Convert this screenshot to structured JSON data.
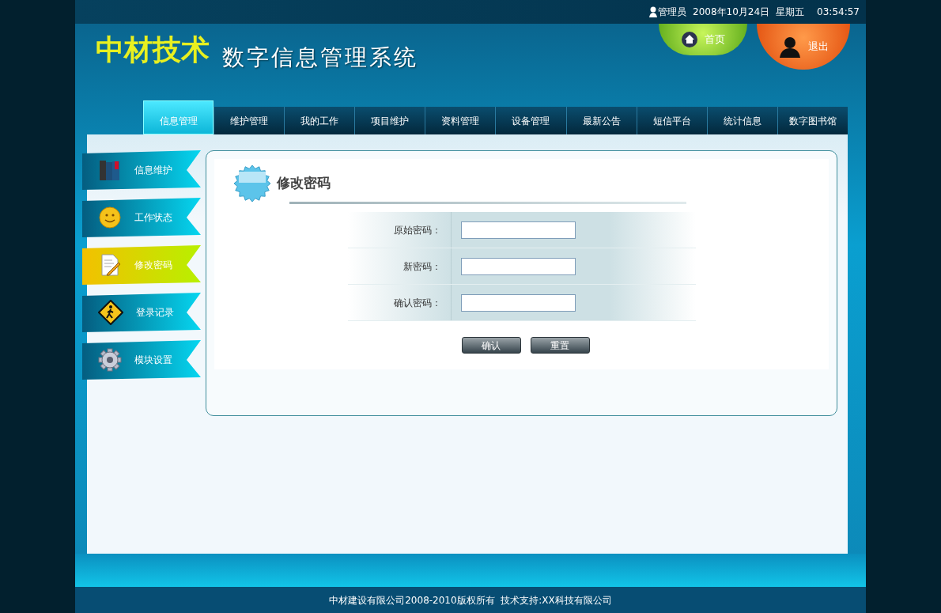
{
  "top_bar": {
    "user": "管理员",
    "date": "2008年10月24日",
    "weekday": "星期五",
    "time": "03:54:57"
  },
  "logo": {
    "brand": "中材技术",
    "system": "数字信息管理系统"
  },
  "header_buttons": [
    {
      "label": "首页",
      "kind": "home"
    },
    {
      "label": "退出",
      "kind": "logout"
    }
  ],
  "tabs": [
    {
      "label": "信息管理",
      "selected": true
    },
    {
      "label": "维护管理",
      "selected": false
    },
    {
      "label": "我的工作",
      "selected": false
    },
    {
      "label": "项目维护",
      "selected": false
    },
    {
      "label": "资料管理",
      "selected": false
    },
    {
      "label": "设备管理",
      "selected": false
    },
    {
      "label": "最新公告",
      "selected": false
    },
    {
      "label": "短信平台",
      "selected": false
    },
    {
      "label": "统计信息",
      "selected": false
    },
    {
      "label": "数字图书馆",
      "selected": false
    }
  ],
  "sidebar": {
    "items": [
      {
        "label": "信息维护",
        "kind": "books",
        "selected": false
      },
      {
        "label": "工作状态",
        "kind": "smiley",
        "selected": false
      },
      {
        "label": "修改密码",
        "kind": "note",
        "selected": true
      },
      {
        "label": "登录记录",
        "kind": "sign",
        "selected": false
      },
      {
        "label": "模块设置",
        "kind": "gear",
        "selected": false
      }
    ]
  },
  "panel": {
    "title": "修改密码",
    "fields": [
      {
        "label": "原始密码："
      },
      {
        "label": "新密码："
      },
      {
        "label": "确认密码："
      }
    ],
    "buttons": [
      "确认",
      "重置"
    ]
  },
  "footer": "中材建设有限公司2008-2010版权所有  技术支持:XX科技有限公司"
}
